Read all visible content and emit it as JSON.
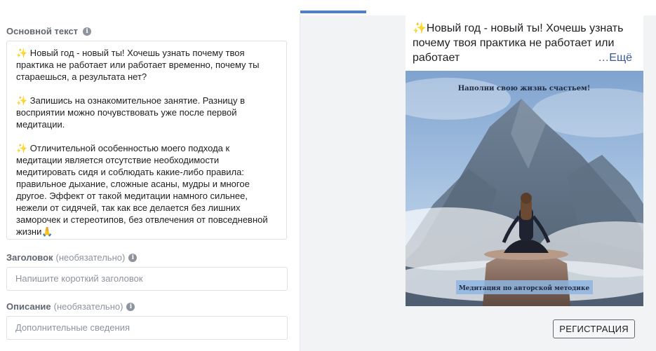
{
  "primary_text": {
    "label": "Основной текст",
    "paragraphs": [
      {
        "spark": "✨",
        "text": " Новый год - новый ты! Хочешь узнать почему твоя практика не работает или работает временно, почему ты стараешься, а результата нет?"
      },
      {
        "spark": "✨",
        "text": " Запишись на ознакомительное занятие. Разницу в восприятии можно почувствовать уже после первой медитации."
      },
      {
        "spark": "✨",
        "text": " Отличительной особенностью моего подхода к медитации является отсутствие необходимости медитировать сидя и соблюдать какие-либо правила: правильное дыхание, сложные асаны, мудры и многое другое. Эффект от такой медитации намного сильнее, нежели от сидячей, так как все делается без лишних заморочек и стереотипов, без отвлечения от повседневной жизни🙏"
      }
    ]
  },
  "headline_field": {
    "label": "Заголовок",
    "optional": "(необязательно)",
    "placeholder": "Напишите короткий заголовок"
  },
  "description_field": {
    "label": "Описание",
    "optional": "(необязательно)",
    "placeholder": "Дополнительные сведения"
  },
  "preview": {
    "spark": "✨",
    "text": "Новый год - новый ты! Хочешь узнать почему твоя практика не работает или работает",
    "more": "…Ещё",
    "image": {
      "top_caption": "Наполни свою жизнь счастьем!",
      "bottom_caption": "Медитация по авторской методике"
    },
    "cta": "РЕГИСТРАЦИЯ"
  }
}
